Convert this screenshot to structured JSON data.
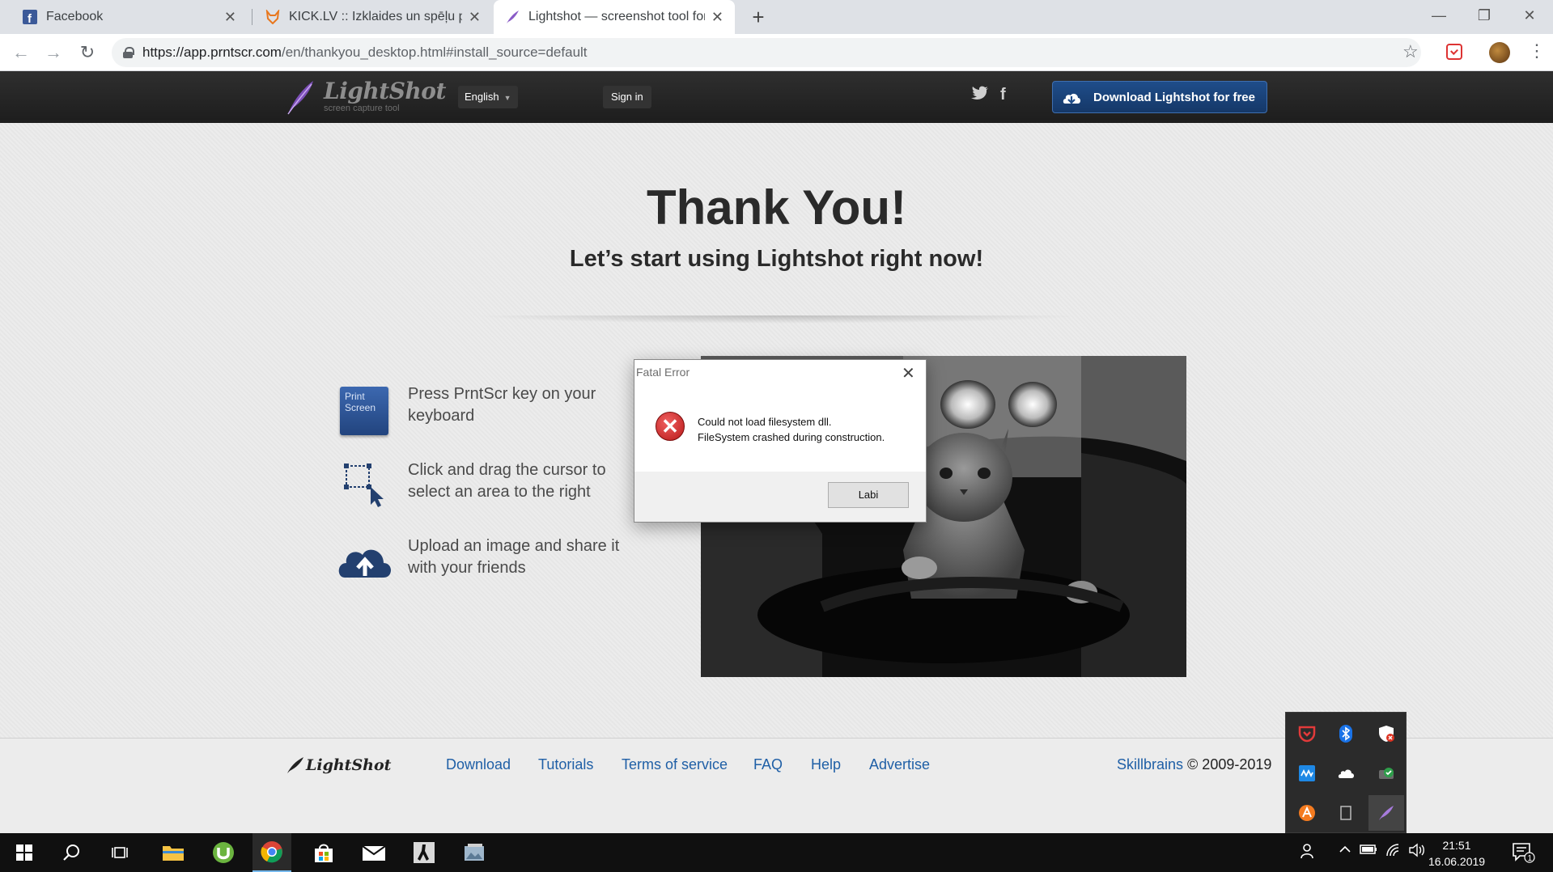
{
  "browser": {
    "tabs": [
      {
        "label": "Facebook",
        "icon": "facebook-icon"
      },
      {
        "label": "KICK.LV :: Izklaides un spēļu portāls",
        "icon": "fox-icon"
      },
      {
        "label": "Lightshot — screenshot tool for Mac & Win",
        "icon": "feather-icon"
      }
    ],
    "active_tab": 2,
    "url_host": "https://app.prntscr.com",
    "url_path": "/en/thankyou_desktop.html#install_source=default"
  },
  "header": {
    "logo_text": "LightShot",
    "logo_subtitle": "screen capture tool",
    "language": "English",
    "signin_label": "Sign in",
    "download_label": "Download Lightshot for free"
  },
  "main": {
    "title": "Thank You!",
    "subtitle": "Let’s start using Lightshot right now!",
    "key_label_line1": "Print",
    "key_label_line2": "Screen",
    "steps": [
      {
        "text": "Press PrntScr key on your keyboard",
        "icon": "print-screen-key-icon"
      },
      {
        "text": "Click and drag the cursor to select an area to the right",
        "icon": "selection-cursor-icon"
      },
      {
        "text": "Upload an image and share it with your friends",
        "icon": "cloud-upload-icon"
      }
    ]
  },
  "footer": {
    "logo_text": "LightShot",
    "links": [
      "Download",
      "Tutorials",
      "Terms of service",
      "FAQ",
      "Help",
      "Advertise"
    ],
    "company": "Skillbrains",
    "copyright": "© 2009-2019"
  },
  "dialog": {
    "title": "Fatal Error",
    "message_line1": "Could not load filesystem dll.",
    "message_line2": "FileSystem crashed during construction.",
    "button_label": "Labi"
  },
  "taskbar": {
    "time": "21:51",
    "date": "16.06.2019",
    "notification_count": "1"
  },
  "colors": {
    "header_bg": "#222222",
    "download_button": "#1f4d8a",
    "link_blue": "#1f5fa6",
    "error_red": "#c62020"
  }
}
